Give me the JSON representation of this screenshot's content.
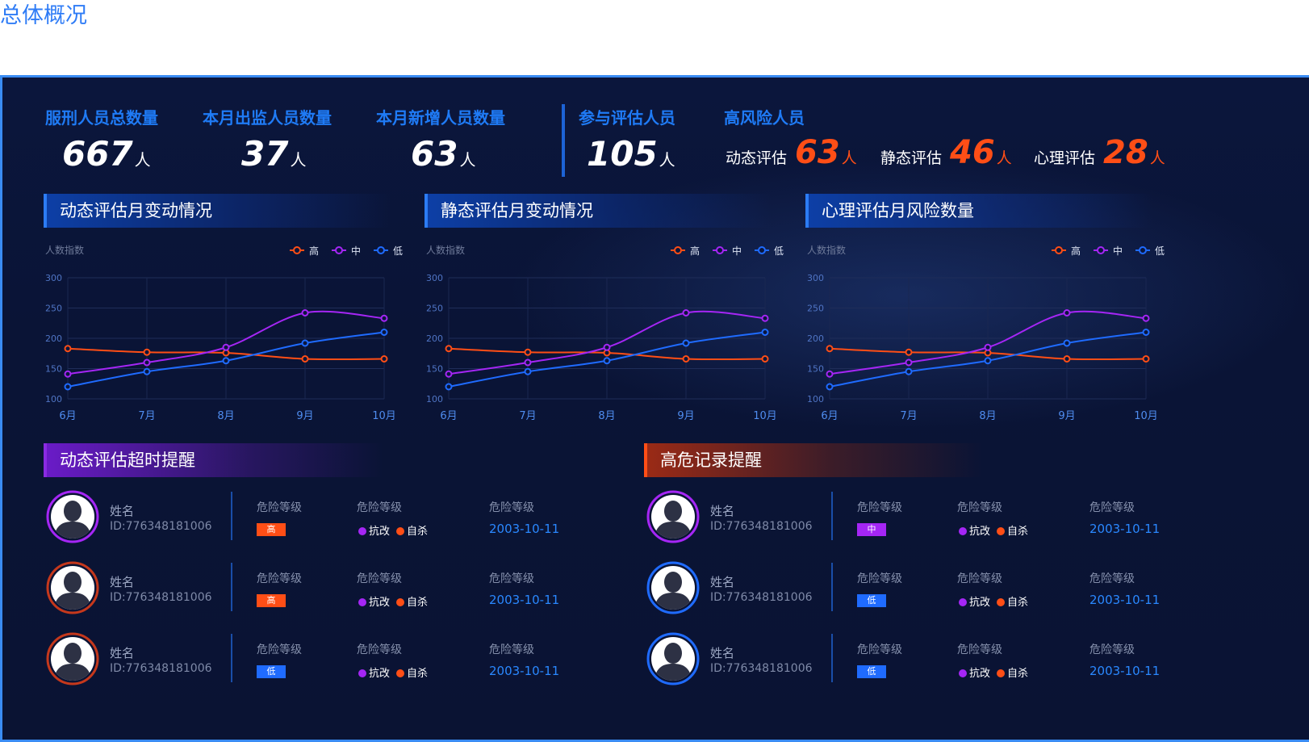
{
  "page_title": "总体概况",
  "stats": {
    "total": {
      "label": "服刑人员总数量",
      "value": "667",
      "unit": "人"
    },
    "out": {
      "label": "本月出监人员数量",
      "value": "37",
      "unit": "人"
    },
    "new": {
      "label": "本月新增人员数量",
      "value": "63",
      "unit": "人"
    },
    "assess": {
      "label": "参与评估人员",
      "value": "105",
      "unit": "人"
    }
  },
  "high_risk": {
    "label": "高风险人员",
    "items": [
      {
        "label": "动态评估",
        "value": "63",
        "unit": "人"
      },
      {
        "label": "静态评估",
        "value": "46",
        "unit": "人"
      },
      {
        "label": "心理评估",
        "value": "28",
        "unit": "人"
      }
    ]
  },
  "colors": {
    "high": "#ff4e16",
    "mid": "#a526f5",
    "low": "#1f6bff",
    "accent": "#2f7cf6"
  },
  "chart_headers": [
    "动态评估月变动情况",
    "静态评估月变动情况",
    "心理评估月风险数量"
  ],
  "chart_data": [
    {
      "type": "line",
      "title": "动态评估月变动情况",
      "ylabel": "人数指数",
      "categories": [
        "6月",
        "7月",
        "8月",
        "9月",
        "10月"
      ],
      "ylim": [
        100,
        300
      ],
      "yticks": [
        "100",
        "150",
        "200",
        "250",
        "300"
      ],
      "legend": "top-right",
      "grid": true,
      "series": [
        {
          "name": "高",
          "values": [
            183,
            177,
            176,
            166,
            166
          ]
        },
        {
          "name": "中",
          "values": [
            141,
            160,
            185,
            242,
            233
          ]
        },
        {
          "name": "低",
          "values": [
            120,
            145,
            163,
            192,
            210
          ]
        }
      ]
    },
    {
      "type": "line",
      "title": "静态评估月变动情况",
      "ylabel": "人数指数",
      "categories": [
        "6月",
        "7月",
        "8月",
        "9月",
        "10月"
      ],
      "ylim": [
        100,
        300
      ],
      "yticks": [
        "100",
        "150",
        "200",
        "250",
        "300"
      ],
      "legend": "top-right",
      "grid": true,
      "series": [
        {
          "name": "高",
          "values": [
            183,
            177,
            176,
            166,
            166
          ]
        },
        {
          "name": "中",
          "values": [
            141,
            160,
            185,
            242,
            233
          ]
        },
        {
          "name": "低",
          "values": [
            120,
            145,
            163,
            192,
            210
          ]
        }
      ]
    },
    {
      "type": "line",
      "title": "心理评估月风险数量",
      "ylabel": "人数指数",
      "categories": [
        "6月",
        "7月",
        "8月",
        "9月",
        "10月"
      ],
      "ylim": [
        100,
        300
      ],
      "yticks": [
        "100",
        "150",
        "200",
        "250",
        "300"
      ],
      "legend": "top-right",
      "grid": true,
      "series": [
        {
          "name": "高",
          "values": [
            183,
            177,
            176,
            166,
            166
          ]
        },
        {
          "name": "中",
          "values": [
            141,
            160,
            185,
            242,
            233
          ]
        },
        {
          "name": "低",
          "values": [
            120,
            145,
            163,
            192,
            210
          ]
        }
      ]
    }
  ],
  "timeout": {
    "header": "动态评估超时提醒",
    "records": [
      {
        "name": "姓名",
        "id": "ID:776348181006",
        "col1": "危险等级",
        "level": "高",
        "col2": "危险等级",
        "tag1": "抗改",
        "tag2": "自杀",
        "col3": "危险等级",
        "date": "2003-10-11",
        "ring": "#a526f5",
        "badge_color": "#ff4e16"
      },
      {
        "name": "姓名",
        "id": "ID:776348181006",
        "col1": "危险等级",
        "level": "高",
        "col2": "危险等级",
        "tag1": "抗改",
        "tag2": "自杀",
        "col3": "危险等级",
        "date": "2003-10-11",
        "ring": "#c5381c",
        "badge_color": "#ff4e16"
      },
      {
        "name": "姓名",
        "id": "ID:776348181006",
        "col1": "危险等级",
        "level": "低",
        "col2": "危险等级",
        "tag1": "抗改",
        "tag2": "自杀",
        "col3": "危险等级",
        "date": "2003-10-11",
        "ring": "#c5381c",
        "badge_color": "#1f6bff"
      }
    ]
  },
  "highrisk_records": {
    "header": "高危记录提醒",
    "records": [
      {
        "name": "姓名",
        "id": "ID:776348181006",
        "col1": "危险等级",
        "level": "中",
        "col2": "危险等级",
        "tag1": "抗改",
        "tag2": "自杀",
        "col3": "危险等级",
        "date": "2003-10-11",
        "ring": "#a526f5",
        "badge_color": "#a526f5"
      },
      {
        "name": "姓名",
        "id": "ID:776348181006",
        "col1": "危险等级",
        "level": "低",
        "col2": "危险等级",
        "tag1": "抗改",
        "tag2": "自杀",
        "col3": "危险等级",
        "date": "2003-10-11",
        "ring": "#1f6bff",
        "badge_color": "#1f6bff"
      },
      {
        "name": "姓名",
        "id": "ID:776348181006",
        "col1": "危险等级",
        "level": "低",
        "col2": "危险等级",
        "tag1": "抗改",
        "tag2": "自杀",
        "col3": "危险等级",
        "date": "2003-10-11",
        "ring": "#1f6bff",
        "badge_color": "#1f6bff"
      }
    ]
  }
}
